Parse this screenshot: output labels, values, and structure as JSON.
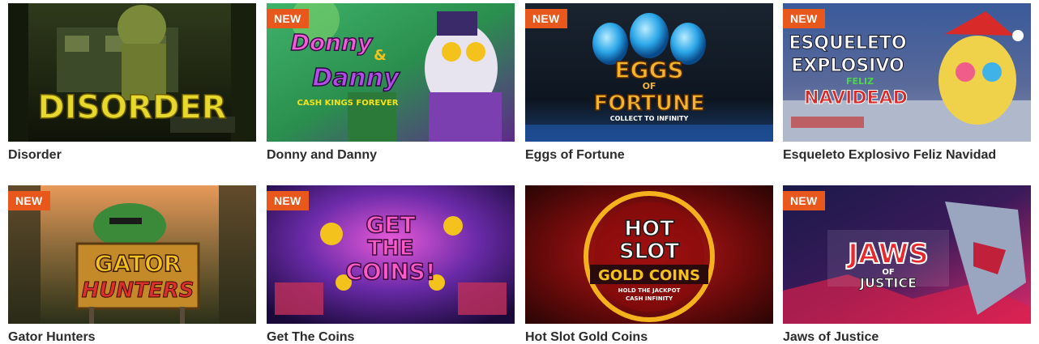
{
  "badge_label": "NEW",
  "games": [
    {
      "title": "Disorder",
      "is_new": false,
      "art_lines": [
        "DISORDER"
      ]
    },
    {
      "title": "Donny and Danny",
      "is_new": true,
      "art_lines": [
        "Donny",
        "&",
        "Danny",
        "CASH KINGS FOREVER"
      ]
    },
    {
      "title": "Eggs of Fortune",
      "is_new": true,
      "art_lines": [
        "EGGS",
        "OF",
        "FORTUNE",
        "COLLECT TO INFINITY"
      ]
    },
    {
      "title": "Esqueleto Explosivo Feliz Navidad",
      "is_new": true,
      "art_lines": [
        "ESQUELETO",
        "EXPLOSIVO",
        "FELIZ",
        "NAVIDEAD"
      ]
    },
    {
      "title": "Gator Hunters",
      "is_new": true,
      "art_lines": [
        "GATOR",
        "HUNTERS"
      ]
    },
    {
      "title": "Get The Coins",
      "is_new": true,
      "art_lines": [
        "GET",
        "THE",
        "COINS!"
      ]
    },
    {
      "title": "Hot Slot Gold Coins",
      "is_new": false,
      "art_lines": [
        "HOT",
        "SLOT",
        "GOLD COINS",
        "HOLD THE JACKPOT",
        "CASH INFINITY"
      ]
    },
    {
      "title": "Jaws of Justice",
      "is_new": true,
      "art_lines": [
        "JAWS",
        "OF",
        "JUSTICE"
      ]
    }
  ]
}
